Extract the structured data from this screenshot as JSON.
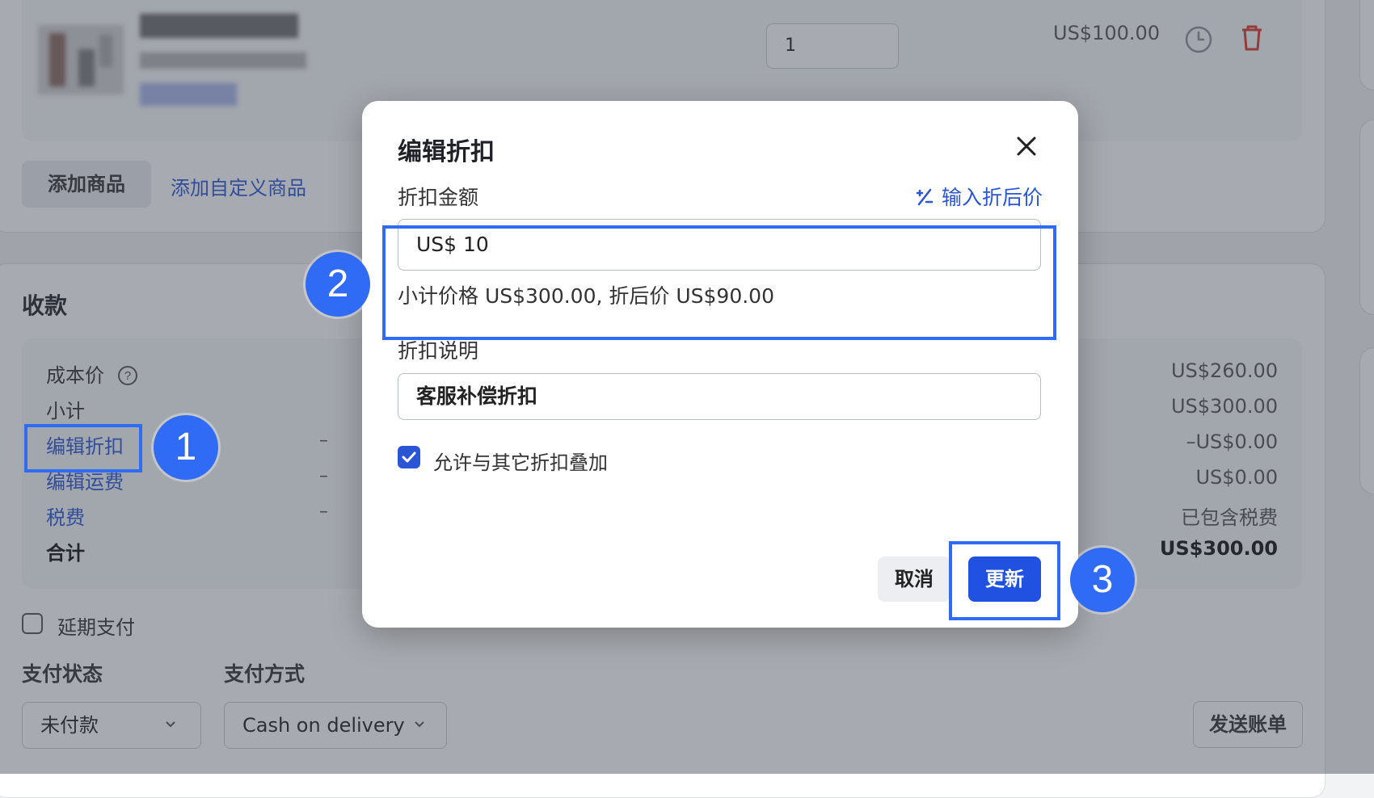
{
  "product": {
    "quantity": "1",
    "price": "US$100.00",
    "add_product_label": "添加商品",
    "add_custom_product_label": "添加自定义商品"
  },
  "payment": {
    "title": "收款",
    "rows": [
      {
        "label": "成本价",
        "dash": "",
        "value": "US$260.00"
      },
      {
        "label": "小计",
        "dash": "",
        "value": "US$300.00"
      },
      {
        "label": "编辑折扣",
        "dash": "–",
        "value": "–US$0.00"
      },
      {
        "label": "编辑运费",
        "dash": "–",
        "value": "US$0.00"
      },
      {
        "label": "税费",
        "dash": "–",
        "value": "已包含税费"
      },
      {
        "label": "合计",
        "dash": "",
        "value": "US$300.00"
      }
    ],
    "defer_payment_label": "延期支付",
    "payment_status_label": "支付状态",
    "payment_status_value": "未付款",
    "payment_method_label": "支付方式",
    "payment_method_value": "Cash on delivery",
    "send_invoice_label": "发送账单"
  },
  "modal": {
    "title": "编辑折扣",
    "amount_label": "折扣金额",
    "enter_discounted_price_link": "输入折后价",
    "amount_value": "US$ 10",
    "summary_text": "小计价格 US$300.00, 折后价 US$90.00",
    "reason_label": "折扣说明",
    "reason_value": "客服补偿折扣",
    "stack_checkbox_label": "允许与其它折扣叠加",
    "stack_checked": true,
    "cancel_label": "取消",
    "update_label": "更新"
  },
  "annotations": {
    "badge_1": "1",
    "badge_2": "2",
    "badge_3": "3",
    "highlight_color": "#2f6bf5"
  },
  "colors": {
    "accent": "#2051e0",
    "link": "#2a56d6",
    "delete": "#d93a2b"
  }
}
